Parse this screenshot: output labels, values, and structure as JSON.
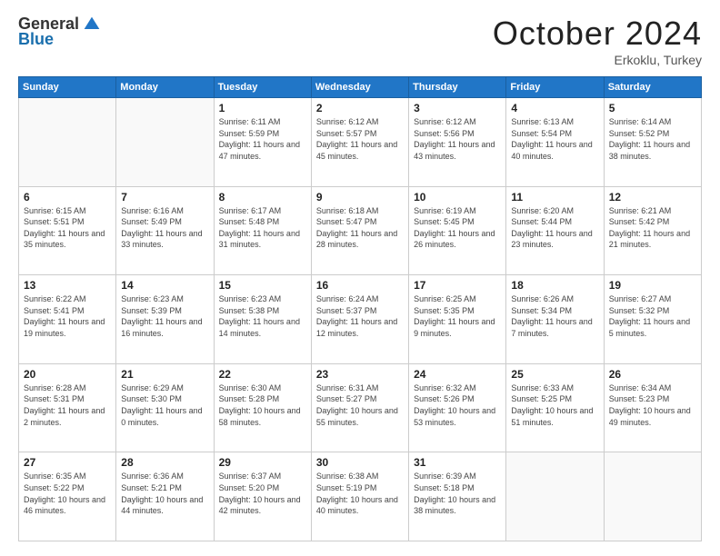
{
  "header": {
    "logo_general": "General",
    "logo_blue": "Blue",
    "month_title": "October 2024",
    "subtitle": "Erkoklu, Turkey"
  },
  "weekdays": [
    "Sunday",
    "Monday",
    "Tuesday",
    "Wednesday",
    "Thursday",
    "Friday",
    "Saturday"
  ],
  "weeks": [
    [
      {
        "day": "",
        "sunrise": "",
        "sunset": "",
        "daylight": ""
      },
      {
        "day": "",
        "sunrise": "",
        "sunset": "",
        "daylight": ""
      },
      {
        "day": "1",
        "sunrise": "Sunrise: 6:11 AM",
        "sunset": "Sunset: 5:59 PM",
        "daylight": "Daylight: 11 hours and 47 minutes."
      },
      {
        "day": "2",
        "sunrise": "Sunrise: 6:12 AM",
        "sunset": "Sunset: 5:57 PM",
        "daylight": "Daylight: 11 hours and 45 minutes."
      },
      {
        "day": "3",
        "sunrise": "Sunrise: 6:12 AM",
        "sunset": "Sunset: 5:56 PM",
        "daylight": "Daylight: 11 hours and 43 minutes."
      },
      {
        "day": "4",
        "sunrise": "Sunrise: 6:13 AM",
        "sunset": "Sunset: 5:54 PM",
        "daylight": "Daylight: 11 hours and 40 minutes."
      },
      {
        "day": "5",
        "sunrise": "Sunrise: 6:14 AM",
        "sunset": "Sunset: 5:52 PM",
        "daylight": "Daylight: 11 hours and 38 minutes."
      }
    ],
    [
      {
        "day": "6",
        "sunrise": "Sunrise: 6:15 AM",
        "sunset": "Sunset: 5:51 PM",
        "daylight": "Daylight: 11 hours and 35 minutes."
      },
      {
        "day": "7",
        "sunrise": "Sunrise: 6:16 AM",
        "sunset": "Sunset: 5:49 PM",
        "daylight": "Daylight: 11 hours and 33 minutes."
      },
      {
        "day": "8",
        "sunrise": "Sunrise: 6:17 AM",
        "sunset": "Sunset: 5:48 PM",
        "daylight": "Daylight: 11 hours and 31 minutes."
      },
      {
        "day": "9",
        "sunrise": "Sunrise: 6:18 AM",
        "sunset": "Sunset: 5:47 PM",
        "daylight": "Daylight: 11 hours and 28 minutes."
      },
      {
        "day": "10",
        "sunrise": "Sunrise: 6:19 AM",
        "sunset": "Sunset: 5:45 PM",
        "daylight": "Daylight: 11 hours and 26 minutes."
      },
      {
        "day": "11",
        "sunrise": "Sunrise: 6:20 AM",
        "sunset": "Sunset: 5:44 PM",
        "daylight": "Daylight: 11 hours and 23 minutes."
      },
      {
        "day": "12",
        "sunrise": "Sunrise: 6:21 AM",
        "sunset": "Sunset: 5:42 PM",
        "daylight": "Daylight: 11 hours and 21 minutes."
      }
    ],
    [
      {
        "day": "13",
        "sunrise": "Sunrise: 6:22 AM",
        "sunset": "Sunset: 5:41 PM",
        "daylight": "Daylight: 11 hours and 19 minutes."
      },
      {
        "day": "14",
        "sunrise": "Sunrise: 6:23 AM",
        "sunset": "Sunset: 5:39 PM",
        "daylight": "Daylight: 11 hours and 16 minutes."
      },
      {
        "day": "15",
        "sunrise": "Sunrise: 6:23 AM",
        "sunset": "Sunset: 5:38 PM",
        "daylight": "Daylight: 11 hours and 14 minutes."
      },
      {
        "day": "16",
        "sunrise": "Sunrise: 6:24 AM",
        "sunset": "Sunset: 5:37 PM",
        "daylight": "Daylight: 11 hours and 12 minutes."
      },
      {
        "day": "17",
        "sunrise": "Sunrise: 6:25 AM",
        "sunset": "Sunset: 5:35 PM",
        "daylight": "Daylight: 11 hours and 9 minutes."
      },
      {
        "day": "18",
        "sunrise": "Sunrise: 6:26 AM",
        "sunset": "Sunset: 5:34 PM",
        "daylight": "Daylight: 11 hours and 7 minutes."
      },
      {
        "day": "19",
        "sunrise": "Sunrise: 6:27 AM",
        "sunset": "Sunset: 5:32 PM",
        "daylight": "Daylight: 11 hours and 5 minutes."
      }
    ],
    [
      {
        "day": "20",
        "sunrise": "Sunrise: 6:28 AM",
        "sunset": "Sunset: 5:31 PM",
        "daylight": "Daylight: 11 hours and 2 minutes."
      },
      {
        "day": "21",
        "sunrise": "Sunrise: 6:29 AM",
        "sunset": "Sunset: 5:30 PM",
        "daylight": "Daylight: 11 hours and 0 minutes."
      },
      {
        "day": "22",
        "sunrise": "Sunrise: 6:30 AM",
        "sunset": "Sunset: 5:28 PM",
        "daylight": "Daylight: 10 hours and 58 minutes."
      },
      {
        "day": "23",
        "sunrise": "Sunrise: 6:31 AM",
        "sunset": "Sunset: 5:27 PM",
        "daylight": "Daylight: 10 hours and 55 minutes."
      },
      {
        "day": "24",
        "sunrise": "Sunrise: 6:32 AM",
        "sunset": "Sunset: 5:26 PM",
        "daylight": "Daylight: 10 hours and 53 minutes."
      },
      {
        "day": "25",
        "sunrise": "Sunrise: 6:33 AM",
        "sunset": "Sunset: 5:25 PM",
        "daylight": "Daylight: 10 hours and 51 minutes."
      },
      {
        "day": "26",
        "sunrise": "Sunrise: 6:34 AM",
        "sunset": "Sunset: 5:23 PM",
        "daylight": "Daylight: 10 hours and 49 minutes."
      }
    ],
    [
      {
        "day": "27",
        "sunrise": "Sunrise: 6:35 AM",
        "sunset": "Sunset: 5:22 PM",
        "daylight": "Daylight: 10 hours and 46 minutes."
      },
      {
        "day": "28",
        "sunrise": "Sunrise: 6:36 AM",
        "sunset": "Sunset: 5:21 PM",
        "daylight": "Daylight: 10 hours and 44 minutes."
      },
      {
        "day": "29",
        "sunrise": "Sunrise: 6:37 AM",
        "sunset": "Sunset: 5:20 PM",
        "daylight": "Daylight: 10 hours and 42 minutes."
      },
      {
        "day": "30",
        "sunrise": "Sunrise: 6:38 AM",
        "sunset": "Sunset: 5:19 PM",
        "daylight": "Daylight: 10 hours and 40 minutes."
      },
      {
        "day": "31",
        "sunrise": "Sunrise: 6:39 AM",
        "sunset": "Sunset: 5:18 PM",
        "daylight": "Daylight: 10 hours and 38 minutes."
      },
      {
        "day": "",
        "sunrise": "",
        "sunset": "",
        "daylight": ""
      },
      {
        "day": "",
        "sunrise": "",
        "sunset": "",
        "daylight": ""
      }
    ]
  ]
}
